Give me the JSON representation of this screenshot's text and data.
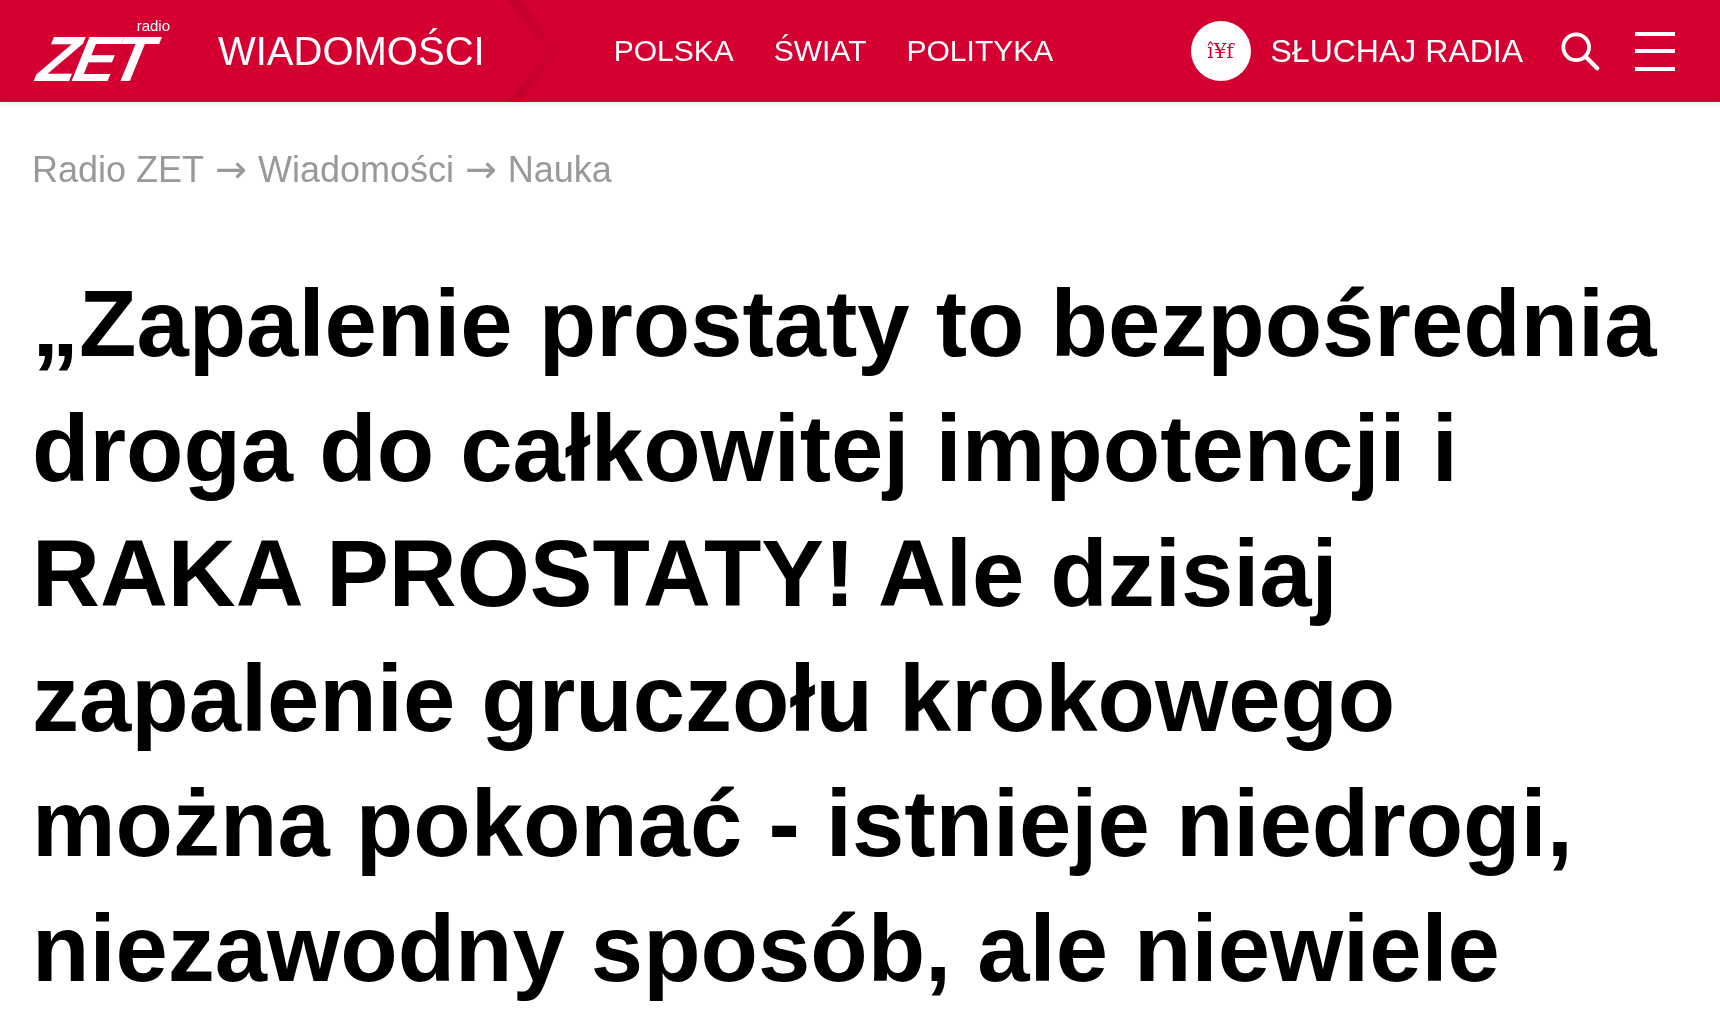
{
  "header": {
    "logo": {
      "tagline": "radio",
      "wordmark": "ZET"
    },
    "section": "WIADOMOŚCI",
    "nav": [
      {
        "label": "POLSKA"
      },
      {
        "label": "ŚWIAT"
      },
      {
        "label": "POLITYKA"
      }
    ],
    "listen": {
      "glyph": "î¥f",
      "label": "SŁUCHAJ RADIA"
    }
  },
  "breadcrumb": [
    {
      "kind": "link",
      "text": "Radio ZET"
    },
    {
      "kind": "separator",
      "text": "→"
    },
    {
      "kind": "link",
      "text": "Wiadomości"
    },
    {
      "kind": "separator",
      "text": "→"
    },
    {
      "kind": "link",
      "text": "Nauka"
    }
  ],
  "headline": "„Zapalenie prostaty to bezpośrednia droga do całkowitej impotencji i RAKA PROSTATY! Ale dzisiaj zapalenie gruczołu krokowego można pokonać - istnieje niedrogi, niezawodny sposób, ale niewiele"
}
